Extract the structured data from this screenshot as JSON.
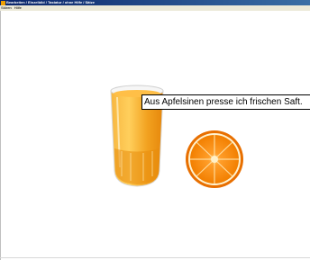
{
  "window": {
    "title": "Bearbeiten / Einzelbild / Tastatur / ohne Hilfe / Sätze"
  },
  "menu": {
    "items": [
      {
        "label": "Stören"
      },
      {
        "label": "Hilfe"
      }
    ]
  },
  "speech": {
    "text": "Aus Apfelsinen presse ich frischen Saft."
  },
  "illustration": {
    "glass_subject": "orange-juice-glass",
    "fruit_subject": "orange-half",
    "colors": {
      "juice": "#f39a12",
      "orange_peel": "#f07a00",
      "orange_flesh": "#ff8f1a"
    }
  }
}
